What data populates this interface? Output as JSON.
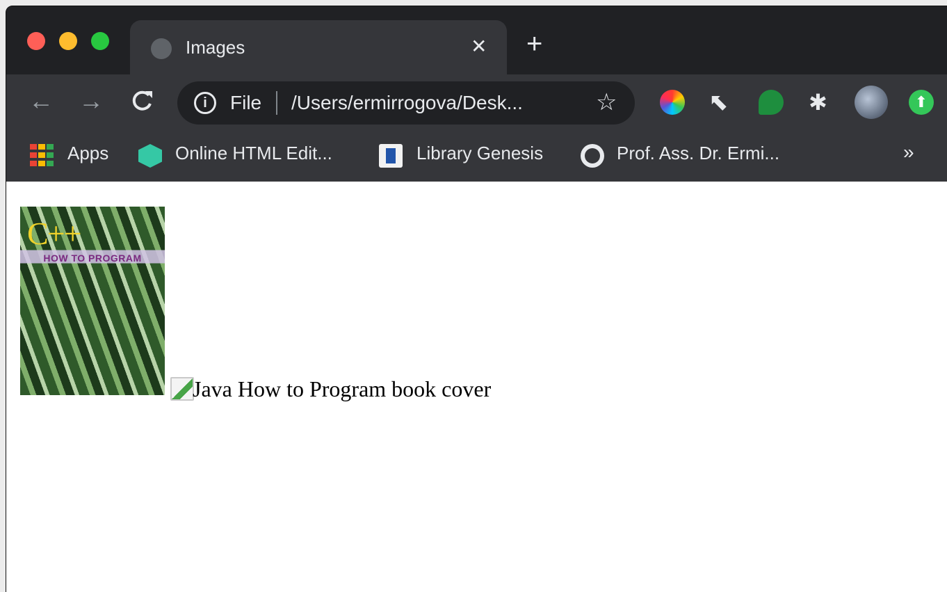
{
  "tab": {
    "title": "Images",
    "close": "✕",
    "new_tab": "+"
  },
  "toolbar": {
    "back": "←",
    "forward": "→",
    "reload": "C",
    "info": "i",
    "scheme": "File",
    "url": "/Users/ermirrogova/Desk...",
    "star": "☆"
  },
  "extensions": [
    {
      "name": "color-picker-icon"
    },
    {
      "name": "cursor-xy-icon",
      "glyph": "⬉"
    },
    {
      "name": "green-chat-icon"
    },
    {
      "name": "puzzle-icon",
      "glyph": "✱"
    },
    {
      "name": "profile-avatar"
    },
    {
      "name": "upload-icon",
      "glyph": "⬆"
    }
  ],
  "bookmarks": {
    "apps": "Apps",
    "html_editor": "Online HTML Edit...",
    "library_genesis": "Library Genesis",
    "prof": "Prof. Ass. Dr. Ermi...",
    "more": "»"
  },
  "page": {
    "cover": {
      "title": "C++",
      "subtitle": "HOW TO PROGRAM"
    },
    "broken_image_alt": "Java How to Program book cover"
  }
}
